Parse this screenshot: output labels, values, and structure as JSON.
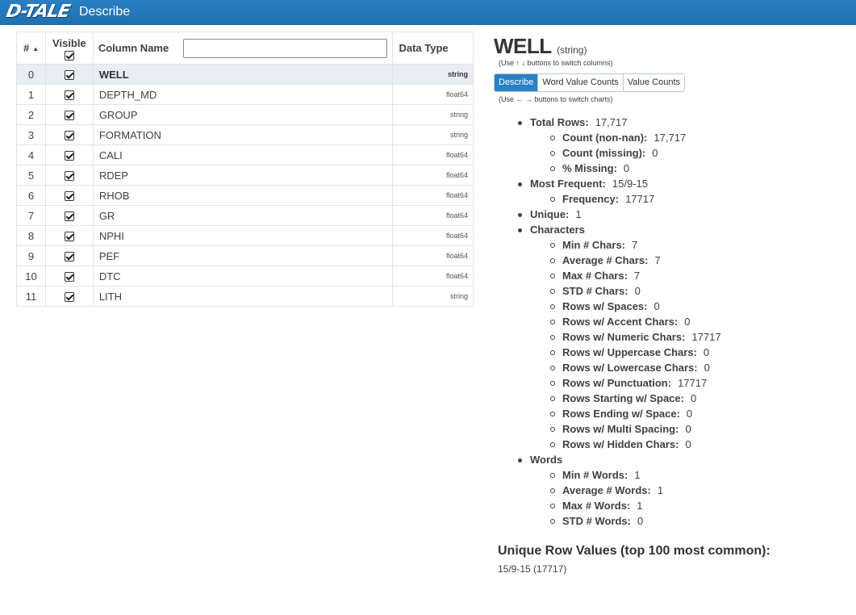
{
  "header": {
    "logo": "D-TALE",
    "page_name": "Describe"
  },
  "table": {
    "headers": {
      "num": "#",
      "visible": "Visible",
      "name": "Column Name",
      "dtype": "Data Type"
    },
    "filter_value": "",
    "selected_index": 0,
    "rows": [
      {
        "index": "0",
        "name": "WELL",
        "dtype": "string",
        "visible": true
      },
      {
        "index": "1",
        "name": "DEPTH_MD",
        "dtype": "float64",
        "visible": true
      },
      {
        "index": "2",
        "name": "GROUP",
        "dtype": "string",
        "visible": true
      },
      {
        "index": "3",
        "name": "FORMATION",
        "dtype": "string",
        "visible": true
      },
      {
        "index": "4",
        "name": "CALI",
        "dtype": "float64",
        "visible": true
      },
      {
        "index": "5",
        "name": "RDEP",
        "dtype": "float64",
        "visible": true
      },
      {
        "index": "6",
        "name": "RHOB",
        "dtype": "float64",
        "visible": true
      },
      {
        "index": "7",
        "name": "GR",
        "dtype": "float64",
        "visible": true
      },
      {
        "index": "8",
        "name": "NPHI",
        "dtype": "float64",
        "visible": true
      },
      {
        "index": "9",
        "name": "PEF",
        "dtype": "float64",
        "visible": true
      },
      {
        "index": "10",
        "name": "DTC",
        "dtype": "float64",
        "visible": true
      },
      {
        "index": "11",
        "name": "LITH",
        "dtype": "string",
        "visible": true
      }
    ]
  },
  "details": {
    "column_name": "WELL",
    "column_dtype": "(string)",
    "hint_columns": "(Use ↑ ↓ buttons to switch columns)",
    "tabs": [
      "Describe",
      "Word Value Counts",
      "Value Counts"
    ],
    "active_tab": 0,
    "hint_charts": "(Use ← → buttons to switch charts)",
    "stats": [
      {
        "level": 1,
        "key": "Total Rows:",
        "value": "17,717"
      },
      {
        "level": 2,
        "key": "Count (non-nan):",
        "value": "17,717"
      },
      {
        "level": 2,
        "key": "Count (missing):",
        "value": "0"
      },
      {
        "level": 2,
        "key": "% Missing:",
        "value": "0"
      },
      {
        "level": 1,
        "key": "Most Frequent:",
        "value": "15/9-15"
      },
      {
        "level": 2,
        "key": "Frequency:",
        "value": "17717"
      },
      {
        "level": 1,
        "key": "Unique:",
        "value": "1"
      },
      {
        "level": 1,
        "key": "Characters",
        "value": ""
      },
      {
        "level": 2,
        "key": "Min # Chars:",
        "value": "7"
      },
      {
        "level": 2,
        "key": "Average # Chars:",
        "value": "7"
      },
      {
        "level": 2,
        "key": "Max # Chars:",
        "value": "7"
      },
      {
        "level": 2,
        "key": "STD # Chars:",
        "value": "0"
      },
      {
        "level": 2,
        "key": "Rows w/ Spaces:",
        "value": "0"
      },
      {
        "level": 2,
        "key": "Rows w/ Accent Chars:",
        "value": "0"
      },
      {
        "level": 2,
        "key": "Rows w/ Numeric Chars:",
        "value": "17717"
      },
      {
        "level": 2,
        "key": "Rows w/ Uppercase Chars:",
        "value": "0"
      },
      {
        "level": 2,
        "key": "Rows w/ Lowercase Chars:",
        "value": "0"
      },
      {
        "level": 2,
        "key": "Rows w/ Punctuation:",
        "value": "17717"
      },
      {
        "level": 2,
        "key": "Rows Starting w/ Space:",
        "value": "0"
      },
      {
        "level": 2,
        "key": "Rows Ending w/ Space:",
        "value": "0"
      },
      {
        "level": 2,
        "key": "Rows w/ Multi Spacing:",
        "value": "0"
      },
      {
        "level": 2,
        "key": "Rows w/ Hidden Chars:",
        "value": "0"
      },
      {
        "level": 1,
        "key": "Words",
        "value": ""
      },
      {
        "level": 2,
        "key": "Min # Words:",
        "value": "1"
      },
      {
        "level": 2,
        "key": "Average # Words:",
        "value": "1"
      },
      {
        "level": 2,
        "key": "Max # Words:",
        "value": "1"
      },
      {
        "level": 2,
        "key": "STD # Words:",
        "value": "0"
      }
    ],
    "unique_title": "Unique Row Values (top 100 most common):",
    "unique_values": "15/9-15 (17717)"
  }
}
